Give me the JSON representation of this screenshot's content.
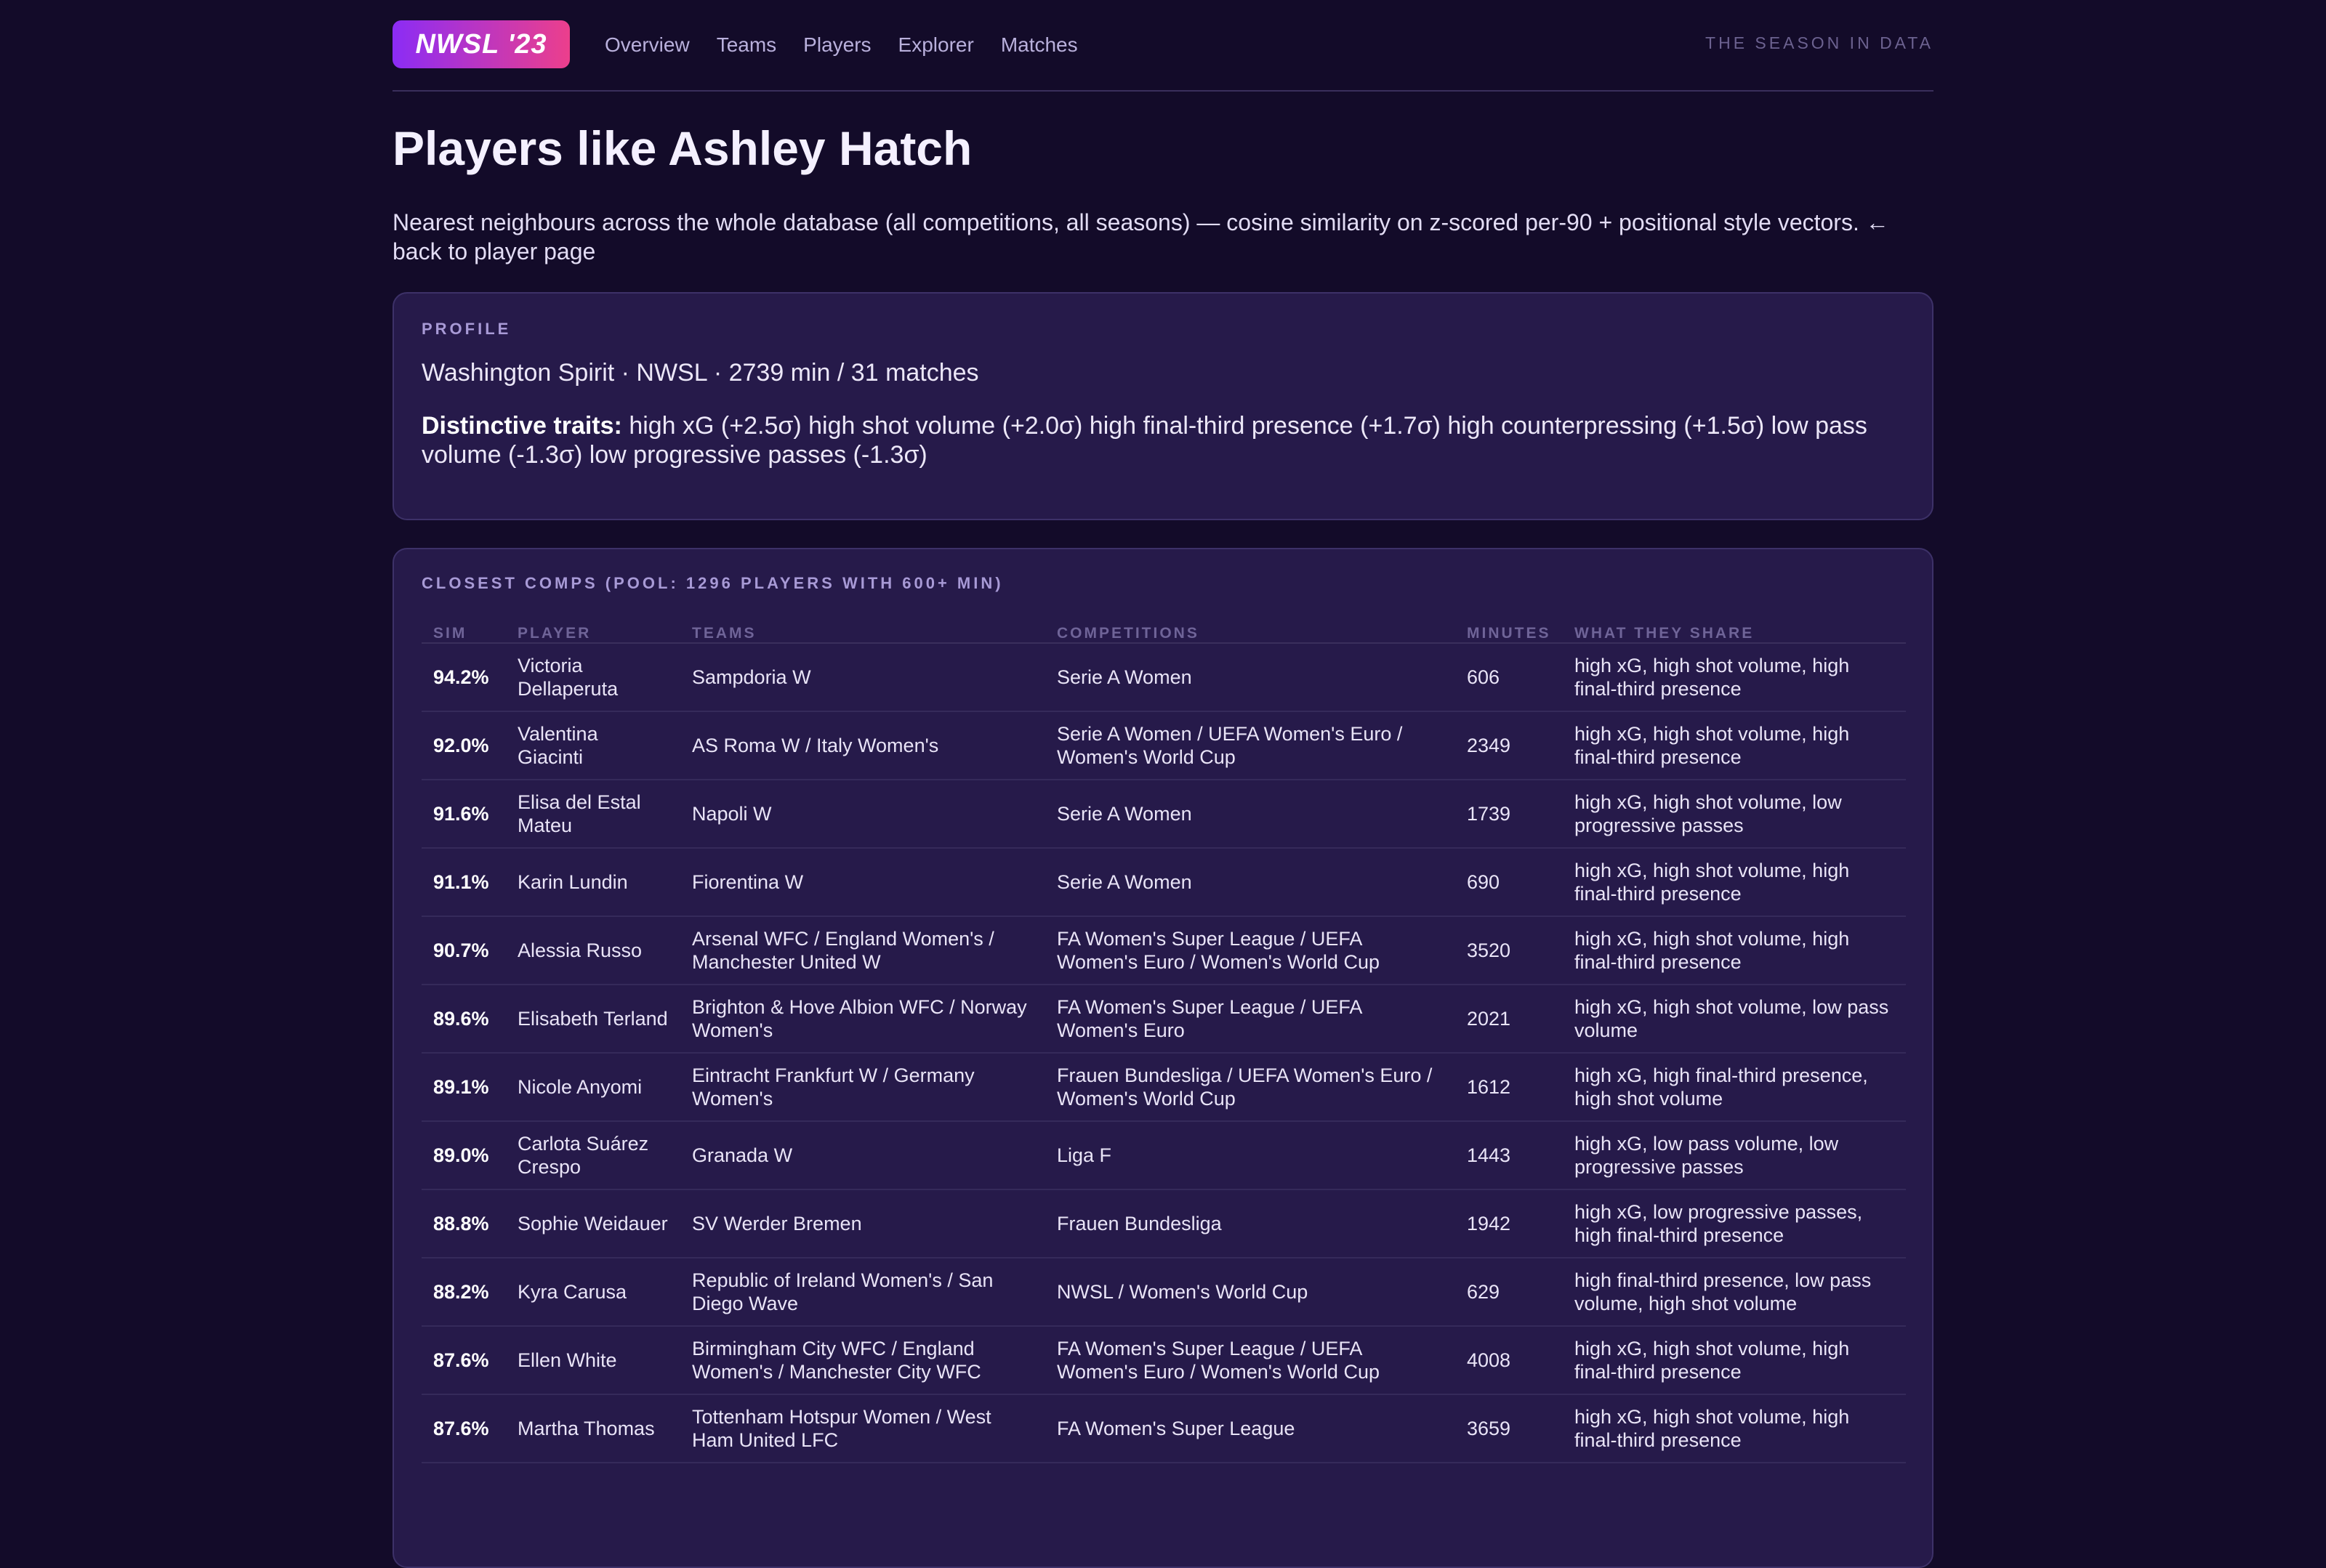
{
  "nav": {
    "logo": "NWSL '23",
    "links": [
      "Overview",
      "Teams",
      "Players",
      "Explorer",
      "Matches"
    ],
    "tagline": "THE SEASON IN DATA"
  },
  "page": {
    "title": "Players like Ashley Hatch",
    "subtitle": "Nearest neighbours across the whole database (all competitions, all seasons) — cosine similarity on z-scored per-90 + positional style vectors.",
    "back_link": "← back to player page"
  },
  "profile": {
    "label": "PROFILE",
    "summary": "Washington Spirit · NWSL · 2739 min / 31 matches",
    "traits_label": "Distinctive traits:",
    "traits": "high xG (+2.5σ) high shot volume (+2.0σ) high final-third presence (+1.7σ) high counterpressing (+1.5σ) low pass volume (-1.3σ) low progressive passes (-1.3σ)"
  },
  "comps": {
    "label": "CLOSEST COMPS (POOL: 1296 PLAYERS WITH 600+ MIN)",
    "columns": [
      "SIM",
      "PLAYER",
      "TEAMS",
      "COMPETITIONS",
      "MINUTES",
      "WHAT THEY SHARE"
    ],
    "rows": [
      {
        "sim": "94.2%",
        "player": "Victoria Dellaperuta",
        "teams": "Sampdoria W",
        "competitions": "Serie A Women",
        "minutes": "606",
        "share": "high xG, high shot volume, high final-third presence"
      },
      {
        "sim": "92.0%",
        "player": "Valentina Giacinti",
        "teams": "AS Roma W / Italy Women's",
        "competitions": "Serie A Women / UEFA Women's Euro / Women's World Cup",
        "minutes": "2349",
        "share": "high xG, high shot volume, high final-third presence"
      },
      {
        "sim": "91.6%",
        "player": "Elisa del Estal Mateu",
        "teams": "Napoli W",
        "competitions": "Serie A Women",
        "minutes": "1739",
        "share": "high xG, high shot volume, low progressive passes"
      },
      {
        "sim": "91.1%",
        "player": "Karin Lundin",
        "teams": "Fiorentina W",
        "competitions": "Serie A Women",
        "minutes": "690",
        "share": "high xG, high shot volume, high final-third presence"
      },
      {
        "sim": "90.7%",
        "player": "Alessia Russo",
        "teams": "Arsenal WFC / England Women's / Manchester United W",
        "competitions": "FA Women's Super League / UEFA Women's Euro / Women's World Cup",
        "minutes": "3520",
        "share": "high xG, high shot volume, high final-third presence"
      },
      {
        "sim": "89.6%",
        "player": "Elisabeth Terland",
        "teams": "Brighton & Hove Albion WFC / Norway Women's",
        "competitions": "FA Women's Super League / UEFA Women's Euro",
        "minutes": "2021",
        "share": "high xG, high shot volume, low pass volume"
      },
      {
        "sim": "89.1%",
        "player": "Nicole Anyomi",
        "teams": "Eintracht Frankfurt W / Germany Women's",
        "competitions": "Frauen Bundesliga / UEFA Women's Euro / Women's World Cup",
        "minutes": "1612",
        "share": "high xG, high final-third presence, high shot volume"
      },
      {
        "sim": "89.0%",
        "player": "Carlota Suárez Crespo",
        "teams": "Granada W",
        "competitions": "Liga F",
        "minutes": "1443",
        "share": "high xG, low pass volume, low progressive passes"
      },
      {
        "sim": "88.8%",
        "player": "Sophie Weidauer",
        "teams": "SV Werder Bremen",
        "competitions": "Frauen Bundesliga",
        "minutes": "1942",
        "share": "high xG, low progressive passes, high final-third presence"
      },
      {
        "sim": "88.2%",
        "player": "Kyra Carusa",
        "teams": "Republic of Ireland Women's / San Diego Wave",
        "competitions": "NWSL / Women's World Cup",
        "minutes": "629",
        "share": "high final-third presence, low pass volume, high shot volume"
      },
      {
        "sim": "87.6%",
        "player": "Ellen White",
        "teams": "Birmingham City WFC / England Women's / Manchester City WFC",
        "competitions": "FA Women's Super League / UEFA Women's Euro / Women's World Cup",
        "minutes": "4008",
        "share": "high xG, high shot volume, high final-third presence"
      },
      {
        "sim": "87.6%",
        "player": "Martha Thomas",
        "teams": "Tottenham Hotspur Women / West Ham United LFC",
        "competitions": "FA Women's Super League",
        "minutes": "3659",
        "share": "high xG, high shot volume, high final-third presence"
      }
    ]
  }
}
